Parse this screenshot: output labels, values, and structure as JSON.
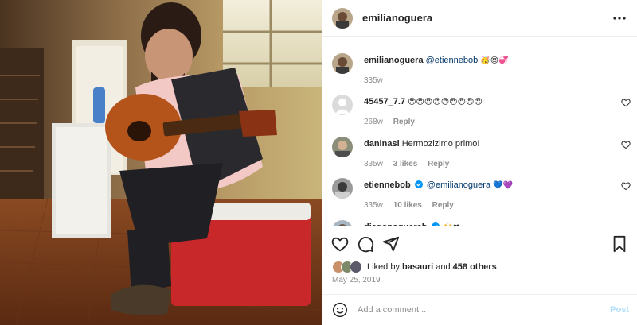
{
  "post": {
    "author": "emilianoguera",
    "date": "May 25, 2019",
    "liked_by_prefix": "Liked by",
    "liked_by_user": "basauri",
    "liked_by_and": "and",
    "liked_by_others": "458 others",
    "add_comment_placeholder": "Add a comment...",
    "post_label": "Post"
  },
  "comments": [
    {
      "user": "emilianoguera",
      "mention": "@etiennebob",
      "text": "",
      "emoji": "🥳😍💞",
      "age": "335w",
      "likes": "",
      "reply": "",
      "has_heart": false,
      "verified": false
    },
    {
      "user": "45457_7.7",
      "mention": "",
      "text": "",
      "emoji": "😍😍😍😍😍😍😍😍😍",
      "age": "268w",
      "likes": "",
      "reply": "Reply",
      "has_heart": true,
      "verified": false
    },
    {
      "user": "daninasi",
      "mention": "",
      "text": "Hermozizimo primo!",
      "emoji": "",
      "age": "335w",
      "likes": "3 likes",
      "reply": "Reply",
      "has_heart": true,
      "verified": false
    },
    {
      "user": "etiennebob",
      "mention": "@emilianoguera",
      "text": "",
      "emoji": "💙💜",
      "age": "335w",
      "likes": "10 likes",
      "reply": "Reply",
      "has_heart": true,
      "verified": true
    },
    {
      "user": "diegonoguerab",
      "mention": "",
      "text": "",
      "emoji": "🙌❤",
      "age": "",
      "likes": "",
      "reply": "",
      "has_heart": false,
      "verified": true
    }
  ],
  "icons": {
    "more": "more-options-icon",
    "like": "heart-icon",
    "comment": "comment-icon",
    "share": "share-icon",
    "save": "bookmark-icon",
    "emoji": "emoji-icon"
  },
  "colors": {
    "link": "#00376b",
    "verified": "#0095f6",
    "muted": "#8e8e8e",
    "post_disabled": "#b2dffc"
  }
}
